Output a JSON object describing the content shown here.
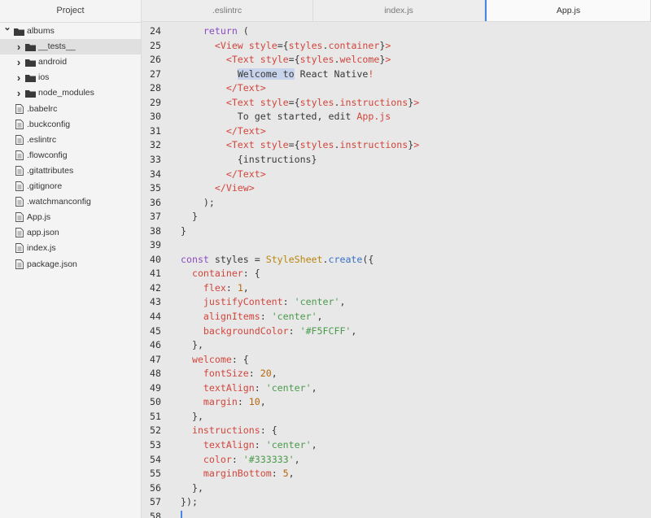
{
  "sidebar": {
    "title": "Project",
    "tree": [
      {
        "label": "albums",
        "type": "folder",
        "depth": 0,
        "expanded": true,
        "selected": false
      },
      {
        "label": "__tests__",
        "type": "folder",
        "depth": 1,
        "expanded": false,
        "selected": true
      },
      {
        "label": "android",
        "type": "folder",
        "depth": 1,
        "expanded": false,
        "selected": false
      },
      {
        "label": "ios",
        "type": "folder",
        "depth": 1,
        "expanded": false,
        "selected": false
      },
      {
        "label": "node_modules",
        "type": "folder",
        "depth": 1,
        "expanded": false,
        "selected": false
      },
      {
        "label": ".babelrc",
        "type": "file",
        "depth": 1,
        "selected": false
      },
      {
        "label": ".buckconfig",
        "type": "file",
        "depth": 1,
        "selected": false
      },
      {
        "label": ".eslintrc",
        "type": "file",
        "depth": 1,
        "selected": false
      },
      {
        "label": ".flowconfig",
        "type": "file",
        "depth": 1,
        "selected": false
      },
      {
        "label": ".gitattributes",
        "type": "file",
        "depth": 1,
        "selected": false
      },
      {
        "label": ".gitignore",
        "type": "file",
        "depth": 1,
        "selected": false
      },
      {
        "label": ".watchmanconfig",
        "type": "file",
        "depth": 1,
        "selected": false
      },
      {
        "label": "App.js",
        "type": "file",
        "depth": 1,
        "selected": false
      },
      {
        "label": "app.json",
        "type": "file",
        "depth": 1,
        "selected": false
      },
      {
        "label": "index.js",
        "type": "file",
        "depth": 1,
        "selected": false
      },
      {
        "label": "package.json",
        "type": "file",
        "depth": 1,
        "selected": false
      }
    ]
  },
  "tabs": [
    {
      "label": ".eslintrc",
      "active": false
    },
    {
      "label": "index.js",
      "active": false
    },
    {
      "label": "App.js",
      "active": true
    }
  ],
  "editor": {
    "active_line": 58,
    "selected_text": "Welcome to",
    "lines": [
      {
        "n": "24",
        "tokens": [
          [
            "    ",
            "p"
          ],
          [
            "return",
            "kw"
          ],
          [
            " (",
            "p"
          ]
        ]
      },
      {
        "n": "25",
        "tokens": [
          [
            "      ",
            "p"
          ],
          [
            "<View ",
            "tag"
          ],
          [
            "style",
            "attr"
          ],
          [
            "={",
            "p"
          ],
          [
            "styles",
            "tag"
          ],
          [
            ".",
            "p"
          ],
          [
            "container",
            "tag"
          ],
          [
            "}",
            "p"
          ],
          [
            ">",
            "tag"
          ]
        ]
      },
      {
        "n": "26",
        "tokens": [
          [
            "        ",
            "p"
          ],
          [
            "<Text ",
            "tag"
          ],
          [
            "style",
            "attr"
          ],
          [
            "={",
            "p"
          ],
          [
            "styles",
            "tag"
          ],
          [
            ".",
            "p"
          ],
          [
            "welcome",
            "tag"
          ],
          [
            "}",
            "p"
          ],
          [
            ">",
            "tag"
          ]
        ]
      },
      {
        "n": "27",
        "tokens": [
          [
            "          ",
            "p"
          ],
          [
            "Welcome to",
            "hl"
          ],
          [
            " React Native",
            "p"
          ],
          [
            "!",
            "tag"
          ]
        ]
      },
      {
        "n": "28",
        "tokens": [
          [
            "        ",
            "p"
          ],
          [
            "</Text>",
            "tag"
          ]
        ]
      },
      {
        "n": "29",
        "tokens": [
          [
            "        ",
            "p"
          ],
          [
            "<Text ",
            "tag"
          ],
          [
            "style",
            "attr"
          ],
          [
            "={",
            "p"
          ],
          [
            "styles",
            "tag"
          ],
          [
            ".",
            "p"
          ],
          [
            "instructions",
            "tag"
          ],
          [
            "}",
            "p"
          ],
          [
            ">",
            "tag"
          ]
        ]
      },
      {
        "n": "30",
        "tokens": [
          [
            "          To get started, edit ",
            "p"
          ],
          [
            "App.js",
            "tag"
          ]
        ]
      },
      {
        "n": "31",
        "tokens": [
          [
            "        ",
            "p"
          ],
          [
            "</Text>",
            "tag"
          ]
        ]
      },
      {
        "n": "32",
        "tokens": [
          [
            "        ",
            "p"
          ],
          [
            "<Text ",
            "tag"
          ],
          [
            "style",
            "attr"
          ],
          [
            "={",
            "p"
          ],
          [
            "styles",
            "tag"
          ],
          [
            ".",
            "p"
          ],
          [
            "instructions",
            "tag"
          ],
          [
            "}",
            "p"
          ],
          [
            ">",
            "tag"
          ]
        ]
      },
      {
        "n": "33",
        "tokens": [
          [
            "          {instructions}",
            "p"
          ]
        ]
      },
      {
        "n": "34",
        "tokens": [
          [
            "        ",
            "p"
          ],
          [
            "</Text>",
            "tag"
          ]
        ]
      },
      {
        "n": "35",
        "tokens": [
          [
            "      ",
            "p"
          ],
          [
            "</View>",
            "tag"
          ]
        ]
      },
      {
        "n": "36",
        "tokens": [
          [
            "    );",
            "p"
          ]
        ]
      },
      {
        "n": "37",
        "tokens": [
          [
            "  }",
            "p"
          ]
        ]
      },
      {
        "n": "38",
        "tokens": [
          [
            "}",
            "p"
          ]
        ]
      },
      {
        "n": "39",
        "tokens": []
      },
      {
        "n": "40",
        "tokens": [
          [
            "const",
            "kw"
          ],
          [
            " styles = ",
            "p"
          ],
          [
            "StyleSheet",
            "cls"
          ],
          [
            ".",
            "p"
          ],
          [
            "create",
            "fn"
          ],
          [
            "({",
            "p"
          ]
        ]
      },
      {
        "n": "41",
        "tokens": [
          [
            "  ",
            "p"
          ],
          [
            "container",
            "prop"
          ],
          [
            ": {",
            "p"
          ]
        ]
      },
      {
        "n": "42",
        "tokens": [
          [
            "    ",
            "p"
          ],
          [
            "flex",
            "prop"
          ],
          [
            ": ",
            "p"
          ],
          [
            "1",
            "num"
          ],
          [
            ",",
            "p"
          ]
        ]
      },
      {
        "n": "43",
        "tokens": [
          [
            "    ",
            "p"
          ],
          [
            "justifyContent",
            "prop"
          ],
          [
            ": ",
            "p"
          ],
          [
            "'center'",
            "str"
          ],
          [
            ",",
            "p"
          ]
        ]
      },
      {
        "n": "44",
        "tokens": [
          [
            "    ",
            "p"
          ],
          [
            "alignItems",
            "prop"
          ],
          [
            ": ",
            "p"
          ],
          [
            "'center'",
            "str"
          ],
          [
            ",",
            "p"
          ]
        ]
      },
      {
        "n": "45",
        "tokens": [
          [
            "    ",
            "p"
          ],
          [
            "backgroundColor",
            "prop"
          ],
          [
            ": ",
            "p"
          ],
          [
            "'#F5FCFF'",
            "str"
          ],
          [
            ",",
            "p"
          ]
        ]
      },
      {
        "n": "46",
        "tokens": [
          [
            "  },",
            "p"
          ]
        ]
      },
      {
        "n": "47",
        "tokens": [
          [
            "  ",
            "p"
          ],
          [
            "welcome",
            "prop"
          ],
          [
            ": {",
            "p"
          ]
        ]
      },
      {
        "n": "48",
        "tokens": [
          [
            "    ",
            "p"
          ],
          [
            "fontSize",
            "prop"
          ],
          [
            ": ",
            "p"
          ],
          [
            "20",
            "num"
          ],
          [
            ",",
            "p"
          ]
        ]
      },
      {
        "n": "49",
        "tokens": [
          [
            "    ",
            "p"
          ],
          [
            "textAlign",
            "prop"
          ],
          [
            ": ",
            "p"
          ],
          [
            "'center'",
            "str"
          ],
          [
            ",",
            "p"
          ]
        ]
      },
      {
        "n": "50",
        "tokens": [
          [
            "    ",
            "p"
          ],
          [
            "margin",
            "prop"
          ],
          [
            ": ",
            "p"
          ],
          [
            "10",
            "num"
          ],
          [
            ",",
            "p"
          ]
        ]
      },
      {
        "n": "51",
        "tokens": [
          [
            "  },",
            "p"
          ]
        ]
      },
      {
        "n": "52",
        "tokens": [
          [
            "  ",
            "p"
          ],
          [
            "instructions",
            "prop"
          ],
          [
            ": {",
            "p"
          ]
        ]
      },
      {
        "n": "53",
        "tokens": [
          [
            "    ",
            "p"
          ],
          [
            "textAlign",
            "prop"
          ],
          [
            ": ",
            "p"
          ],
          [
            "'center'",
            "str"
          ],
          [
            ",",
            "p"
          ]
        ]
      },
      {
        "n": "54",
        "tokens": [
          [
            "    ",
            "p"
          ],
          [
            "color",
            "prop"
          ],
          [
            ": ",
            "p"
          ],
          [
            "'#333333'",
            "str"
          ],
          [
            ",",
            "p"
          ]
        ]
      },
      {
        "n": "55",
        "tokens": [
          [
            "    ",
            "p"
          ],
          [
            "marginBottom",
            "prop"
          ],
          [
            ": ",
            "p"
          ],
          [
            "5",
            "num"
          ],
          [
            ",",
            "p"
          ]
        ]
      },
      {
        "n": "56",
        "tokens": [
          [
            "  },",
            "p"
          ]
        ]
      },
      {
        "n": "57",
        "tokens": [
          [
            "});",
            "p"
          ]
        ]
      },
      {
        "n": "58",
        "tokens": []
      }
    ]
  },
  "colors": {
    "accent": "#4a86e8",
    "tag": "#d2453c",
    "string": "#4a9a4a",
    "number": "#b8660a",
    "keyword": "#8a4cbf",
    "function": "#3a70c8",
    "class": "#b8860b",
    "selection": "#c8d4ec"
  }
}
